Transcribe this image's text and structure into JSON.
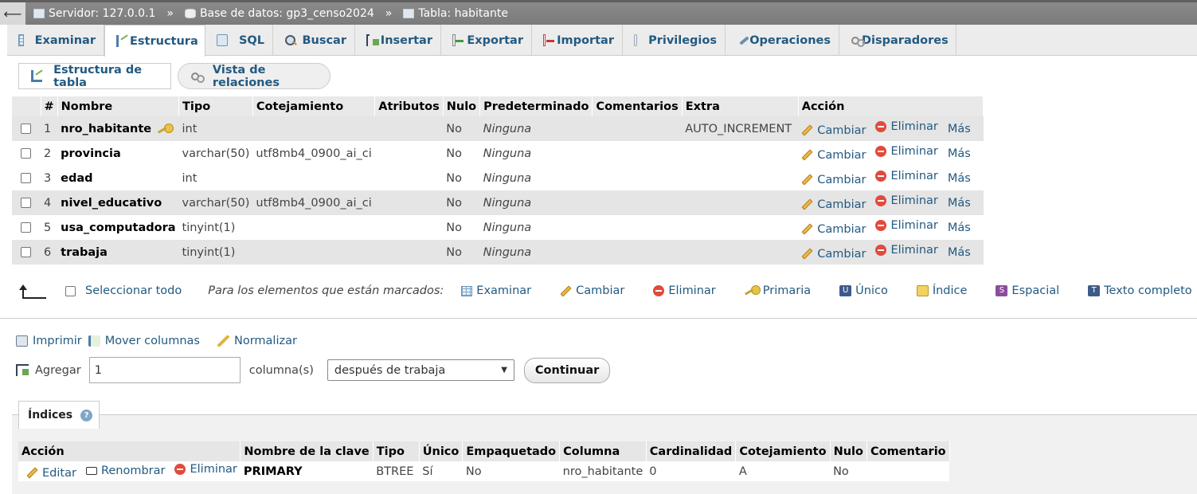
{
  "breadcrumb": {
    "server": "Servidor: 127.0.0.1",
    "database": "Base de datos: gp3_censo2024",
    "table": "Tabla: habitante",
    "separator": "»"
  },
  "tabs": [
    {
      "label": "Examinar",
      "icon": "browse-icon"
    },
    {
      "label": "Estructura",
      "icon": "structure-icon",
      "active": true
    },
    {
      "label": "SQL",
      "icon": "sql-icon"
    },
    {
      "label": "Buscar",
      "icon": "search-icon"
    },
    {
      "label": "Insertar",
      "icon": "insert-icon"
    },
    {
      "label": "Exportar",
      "icon": "export-icon"
    },
    {
      "label": "Importar",
      "icon": "import-icon"
    },
    {
      "label": "Privilegios",
      "icon": "privileges-icon"
    },
    {
      "label": "Operaciones",
      "icon": "wrench-icon"
    },
    {
      "label": "Disparadores",
      "icon": "triggers-icon"
    }
  ],
  "subtabs": {
    "structure": "Estructura de tabla",
    "relations": "Vista de relaciones"
  },
  "columns_table": {
    "headers": [
      "#",
      "Nombre",
      "Tipo",
      "Cotejamiento",
      "Atributos",
      "Nulo",
      "Predeterminado",
      "Comentarios",
      "Extra",
      "Acción"
    ],
    "rows": [
      {
        "num": "1",
        "name": "nro_habitante",
        "type": "int",
        "collation": "",
        "attributes": "",
        "null": "No",
        "default": "Ninguna",
        "comments": "",
        "extra": "AUTO_INCREMENT",
        "primary": true
      },
      {
        "num": "2",
        "name": "provincia",
        "type": "varchar(50)",
        "collation": "utf8mb4_0900_ai_ci",
        "attributes": "",
        "null": "No",
        "default": "Ninguna",
        "comments": "",
        "extra": ""
      },
      {
        "num": "3",
        "name": "edad",
        "type": "int",
        "collation": "",
        "attributes": "",
        "null": "No",
        "default": "Ninguna",
        "comments": "",
        "extra": ""
      },
      {
        "num": "4",
        "name": "nivel_educativo",
        "type": "varchar(50)",
        "collation": "utf8mb4_0900_ai_ci",
        "attributes": "",
        "null": "No",
        "default": "Ninguna",
        "comments": "",
        "extra": ""
      },
      {
        "num": "5",
        "name": "usa_computadora",
        "type": "tinyint(1)",
        "collation": "",
        "attributes": "",
        "null": "No",
        "default": "Ninguna",
        "comments": "",
        "extra": ""
      },
      {
        "num": "6",
        "name": "trabaja",
        "type": "tinyint(1)",
        "collation": "",
        "attributes": "",
        "null": "No",
        "default": "Ninguna",
        "comments": "",
        "extra": ""
      }
    ],
    "actions": {
      "change": "Cambiar",
      "drop": "Eliminar",
      "more": "Más"
    }
  },
  "bulk": {
    "select_all": "Seleccionar todo",
    "with_selected": "Para los elementos que están marcados:",
    "actions": [
      "Examinar",
      "Cambiar",
      "Eliminar",
      "Primaria",
      "Único",
      "Índice",
      "Espacial",
      "Texto completo"
    ]
  },
  "tools": {
    "print": "Imprimir",
    "move_columns": "Mover columnas",
    "normalize": "Normalizar"
  },
  "add_columns": {
    "label": "Agregar",
    "count": "1",
    "unit": "columna(s)",
    "position": "después de trabaja",
    "submit": "Continuar"
  },
  "indexes": {
    "title": "Índices",
    "help": "?",
    "headers": [
      "Acción",
      "Nombre de la clave",
      "Tipo",
      "Único",
      "Empaquetado",
      "Columna",
      "Cardinalidad",
      "Cotejamiento",
      "Nulo",
      "Comentario"
    ],
    "actions": {
      "edit": "Editar",
      "rename": "Renombrar",
      "drop": "Eliminar"
    },
    "rows": [
      {
        "key_name": "PRIMARY",
        "type": "BTREE",
        "unique": "Sí",
        "packed": "No",
        "column": "nro_habitante",
        "cardinality": "0",
        "collation": "A",
        "null": "No",
        "comment": ""
      }
    ]
  }
}
